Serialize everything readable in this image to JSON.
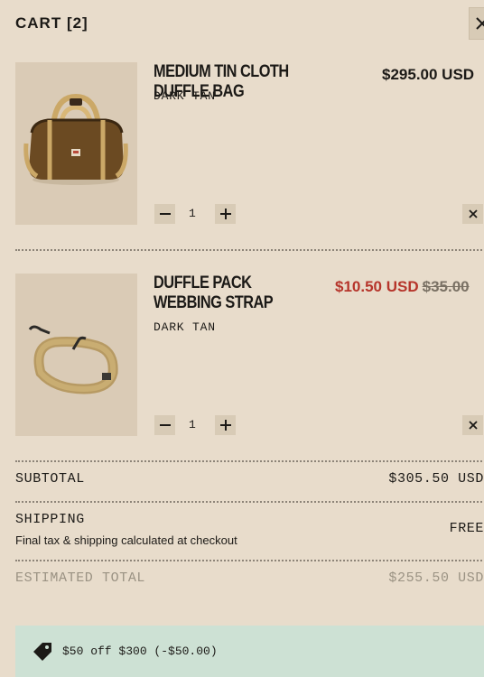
{
  "cart": {
    "title": "CART [2]",
    "close_icon": "close-icon"
  },
  "items": [
    {
      "name": "MEDIUM TIN CLOTH DUFFLE BAG",
      "variant": "DARK TAN",
      "price": "$295.00 USD",
      "quantity": "1"
    },
    {
      "name": "DUFFLE PACK WEBBING STRAP",
      "variant": "DARK TAN",
      "sale_price": "$10.50 USD",
      "original_price": "$35.00",
      "quantity": "1"
    }
  ],
  "summary": {
    "subtotal_label": "SUBTOTAL",
    "subtotal_value": "$305.50 USD",
    "shipping_label": "SHIPPING",
    "shipping_value": "FREE",
    "shipping_note": "Final tax & shipping calculated at checkout",
    "estimated_label": "ESTIMATED TOTAL",
    "estimated_value": "$255.50 USD"
  },
  "promo": {
    "icon": "tag-icon",
    "text": "$50 off $300 (-$50.00)"
  },
  "colors": {
    "background": "#e8dccb",
    "sale": "#b6352b",
    "promo_bg": "#cde1d4"
  }
}
